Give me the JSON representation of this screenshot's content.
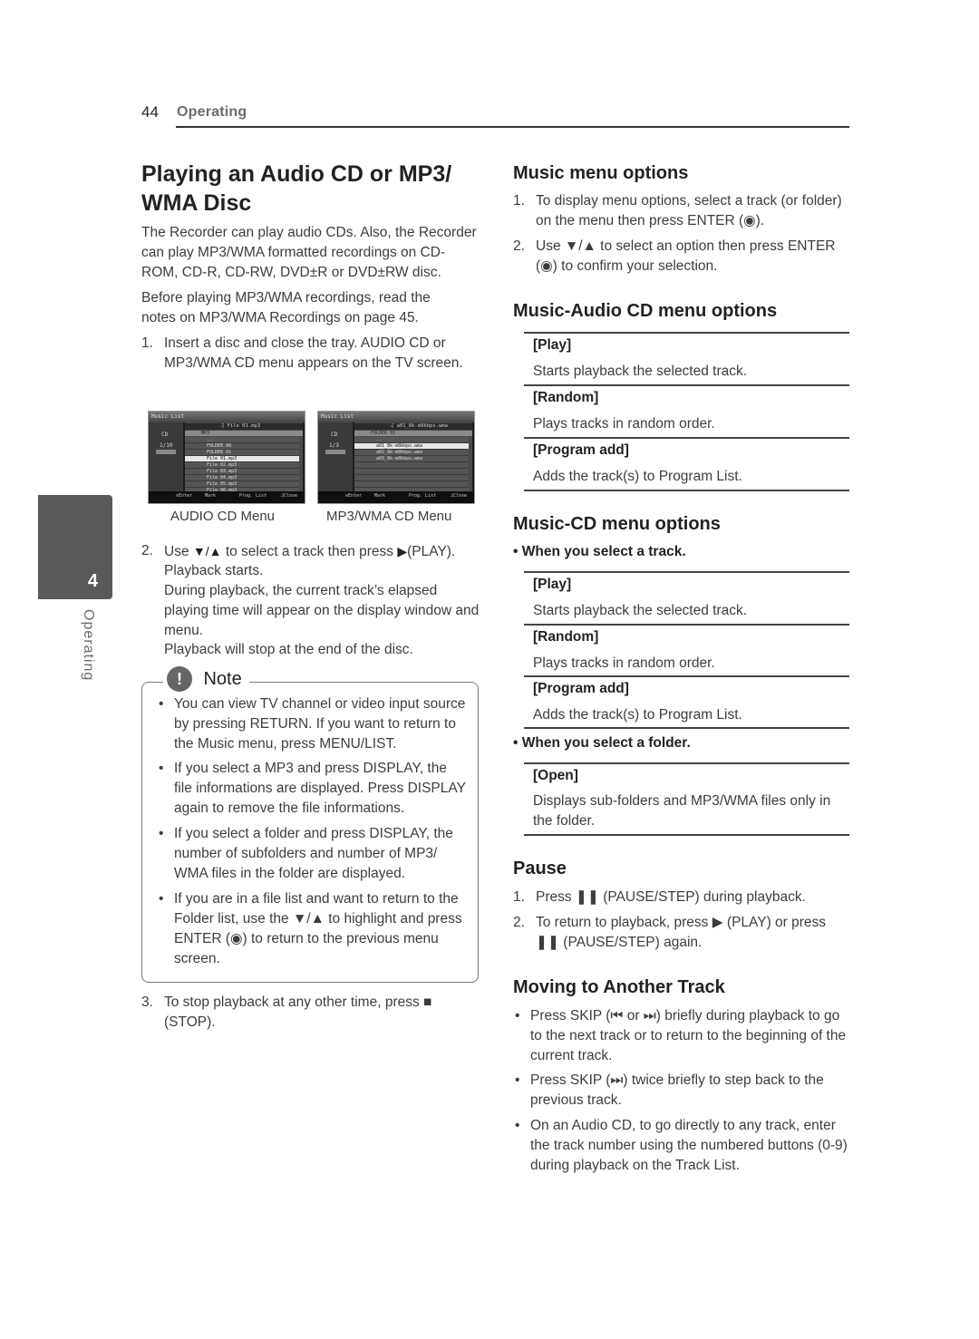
{
  "header": {
    "page_number": "44",
    "section": "Operating"
  },
  "side_tab": {
    "chapter": "4",
    "label": "Operating"
  },
  "left": {
    "title": "Playing an Audio CD or MP3/ WMA Disc",
    "intro1": "The Recorder can play audio CDs. Also, the Recorder can play MP3/WMA formatted recordings on CD-ROM, CD-R, CD-RW, DVD±R or DVD±RW disc.",
    "intro2": "Before playing MP3/WMA recordings, read the notes on MP3/WMA Recordings on page 45.",
    "step1_num": "1.",
    "step1": "Insert a disc and close the tray. AUDIO CD or MP3/WMA CD menu appears on the TV screen.",
    "screens": [
      {
        "caption": "AUDIO CD Menu",
        "top_title": "Music List",
        "now_playing": "♫ File 01.mp3",
        "path": "MP3",
        "disc": "CD",
        "count": "1/10",
        "rows": [
          "..",
          "FOLDER 00",
          "FOLDER 01",
          "File 01.mp3",
          "File 02.mp3",
          "File 03.mp3",
          "File 04.mp3",
          "File 05.mp3",
          "File 06.mp3"
        ],
        "selected_index": 3,
        "footer": [
          "⊙Enter",
          "Mark",
          "Prog. List",
          "♫Close"
        ]
      },
      {
        "caption": "MP3/WMA CD Menu",
        "top_title": "Music List",
        "now_playing": "♫ a01_8k-m8kbps.wma",
        "path": "FOLDER 01",
        "disc": "CD",
        "count": "1/3",
        "rows": [
          "..",
          "a01_8k-m8kbps.wma",
          "a02_8k-m8kbps.wma",
          "a03_8k-m8kbps.wma"
        ],
        "selected_index": 1,
        "footer": [
          "⊙Enter",
          "Mark",
          "Prog. List",
          "♫Close"
        ]
      }
    ],
    "step2_num": "2.",
    "step2_a": "Use",
    "step2_b": "to select a track then press",
    "step2_c": "(PLAY).",
    "step2_rest": [
      "Playback starts.",
      "During playback, the current track’s elapsed playing time will appear on the display window and menu.",
      "Playback will stop at the end of the disc."
    ],
    "note": {
      "title": "Note",
      "items": [
        "You can view TV channel or video input source by pressing RETURN. If you want to return to the Music menu, press MENU/LIST.",
        "If you select a MP3 and press DISPLAY, the file informations are displayed. Press DISPLAY again to remove the file informations.",
        "If you select a folder and press DISPLAY, the number of subfolders and number of MP3/ WMA files in the folder are displayed.",
        "If you are in a file list and want to return to the Folder list, use the ▼/▲ to highlight and press ENTER (◉) to return to the previous menu screen."
      ]
    },
    "step3_num": "3.",
    "step3": "To stop playback at any other time, press ■ (STOP)."
  },
  "right": {
    "music_menu": {
      "title": "Music menu options",
      "steps": [
        {
          "num": "1.",
          "text": "To display menu options, select a track (or folder) on the menu then press ENTER (◉)."
        },
        {
          "num": "2.",
          "text": "Use ▼/▲ to select an option then press ENTER (◉) to confirm your selection."
        }
      ]
    },
    "audio_cd_menu": {
      "title": "Music-Audio CD menu options",
      "options": [
        {
          "label": "[Play]",
          "desc": "Starts playback the selected track."
        },
        {
          "label": "[Random]",
          "desc": "Plays tracks in random order."
        },
        {
          "label": "[Program add]",
          "desc": "Adds the track(s) to Program List."
        }
      ]
    },
    "cd_menu": {
      "title": "Music-CD menu options",
      "track_head": "• When you select a track.",
      "track_options": [
        {
          "label": "[Play]",
          "desc": "Starts playback the selected track."
        },
        {
          "label": "[Random]",
          "desc": "Plays tracks in random order."
        },
        {
          "label": "[Program add]",
          "desc": "Adds the track(s) to Program List."
        }
      ],
      "folder_head": "• When you select a folder.",
      "folder_options": [
        {
          "label": "[Open]",
          "desc": "Displays sub-folders and MP3/WMA files only in the folder."
        }
      ]
    },
    "pause": {
      "title": "Pause",
      "steps": [
        {
          "num": "1.",
          "text": "Press ❚❚ (PAUSE/STEP) during playback."
        },
        {
          "num": "2.",
          "text": "To return to playback, press ▶  (PLAY) or press ❚❚ (PAUSE/STEP) again."
        }
      ]
    },
    "moving": {
      "title": "Moving to Another Track",
      "items": [
        "Press SKIP (⏮ or ⏭) briefly during playback to go to the next track or to return to the beginning of the current track.",
        "Press SKIP (⏭) twice briefly to step back to the previous track.",
        "On an Audio CD, to go directly to any track, enter the track number using the numbered buttons (0-9) during playback on the Track List."
      ]
    }
  }
}
